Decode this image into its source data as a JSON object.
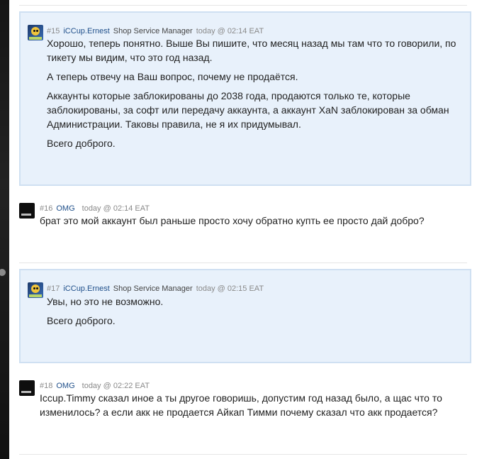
{
  "posts": [
    {
      "num": "#15",
      "author": "iCCup.Ernest",
      "role": "Shop Service Manager",
      "time": "today @ 02:14 EAT",
      "paragraphs": [
        "Хорошо, теперь понятно. Выше Вы пишите, что месяц назад мы там что то говорили, по тикету мы видим, что это год назад.",
        "А теперь отвечу на Ваш вопрос, почему не продаётся.",
        "Аккаунты которые заблокированы до 2038 года, продаются только те, которые заблокированы, за софт или передачу аккаунта, а аккаунт XaN заблокирован за обман Администрации. Таковы правила, не я их придумывал.",
        "Всего доброго."
      ]
    },
    {
      "num": "#16",
      "author": "OMG",
      "time": "today @ 02:14 EAT",
      "paragraphs": [
        "брат это мой аккаунт был раньше просто хочу обратно купть ее просто дай добро?"
      ]
    },
    {
      "num": "#17",
      "author": "iCCup.Ernest",
      "role": "Shop Service Manager",
      "time": "today @ 02:15 EAT",
      "paragraphs": [
        "Увы, но это не возможно.",
        "Всего доброго."
      ]
    },
    {
      "num": "#18",
      "author": "OMG",
      "time": "today @ 02:22 EAT",
      "paragraphs": [
        "Iccup.Timmy сказал иное а ты другое говоришь, допустим год назад было, а щас что то изменилось? а если акк не продается Айкап Тимми почему сказал что акк продается?"
      ]
    }
  ]
}
